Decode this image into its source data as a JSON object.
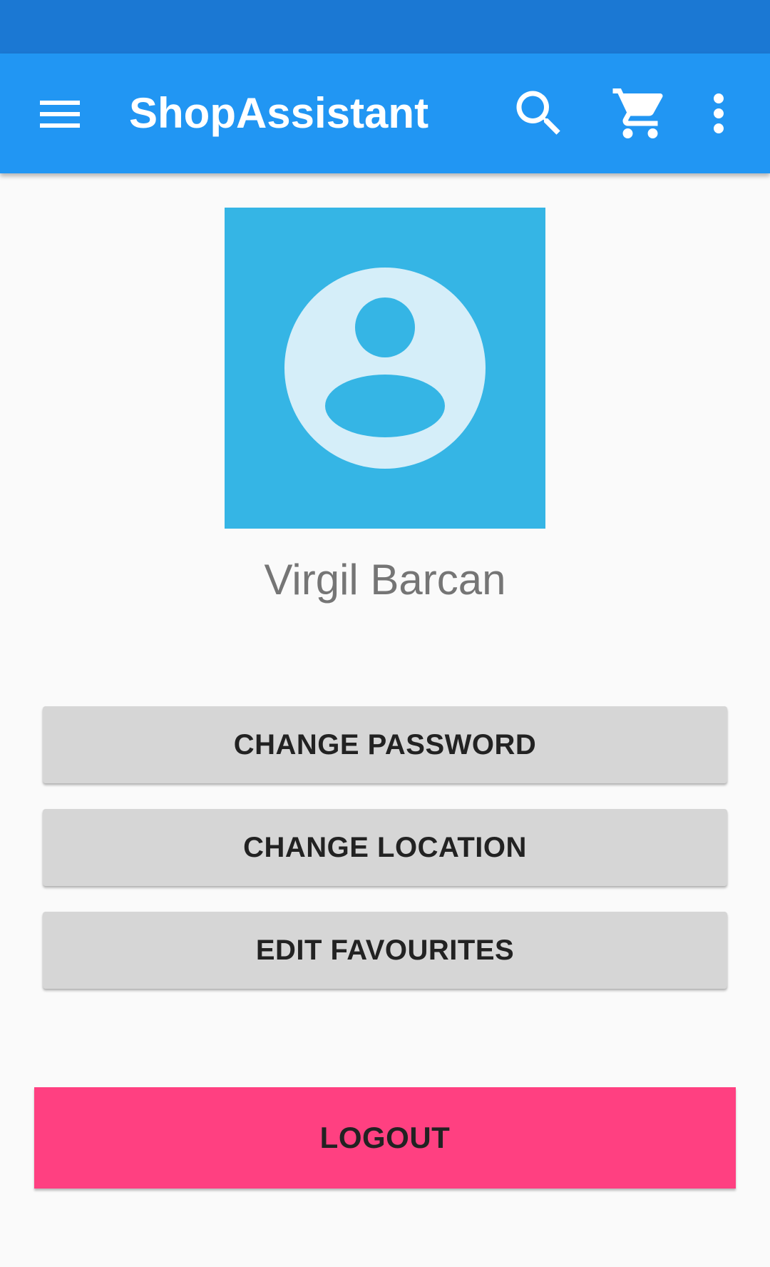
{
  "app_bar": {
    "title": "ShopAssistant",
    "background": "#2196f3",
    "status_bar_color": "#1b78d3",
    "icons": [
      "menu-icon",
      "search-icon",
      "cart-icon",
      "more-vert-icon"
    ]
  },
  "profile": {
    "avatar_icon": "account-circle-icon",
    "avatar_background": "#35b5e5",
    "name": "Virgil Barcan"
  },
  "actions": {
    "change_password": "CHANGE PASSWORD",
    "change_location": "CHANGE LOCATION",
    "edit_favourites": "EDIT FAVOURITES",
    "logout": "LOGOUT",
    "logout_color": "#ff4081"
  }
}
